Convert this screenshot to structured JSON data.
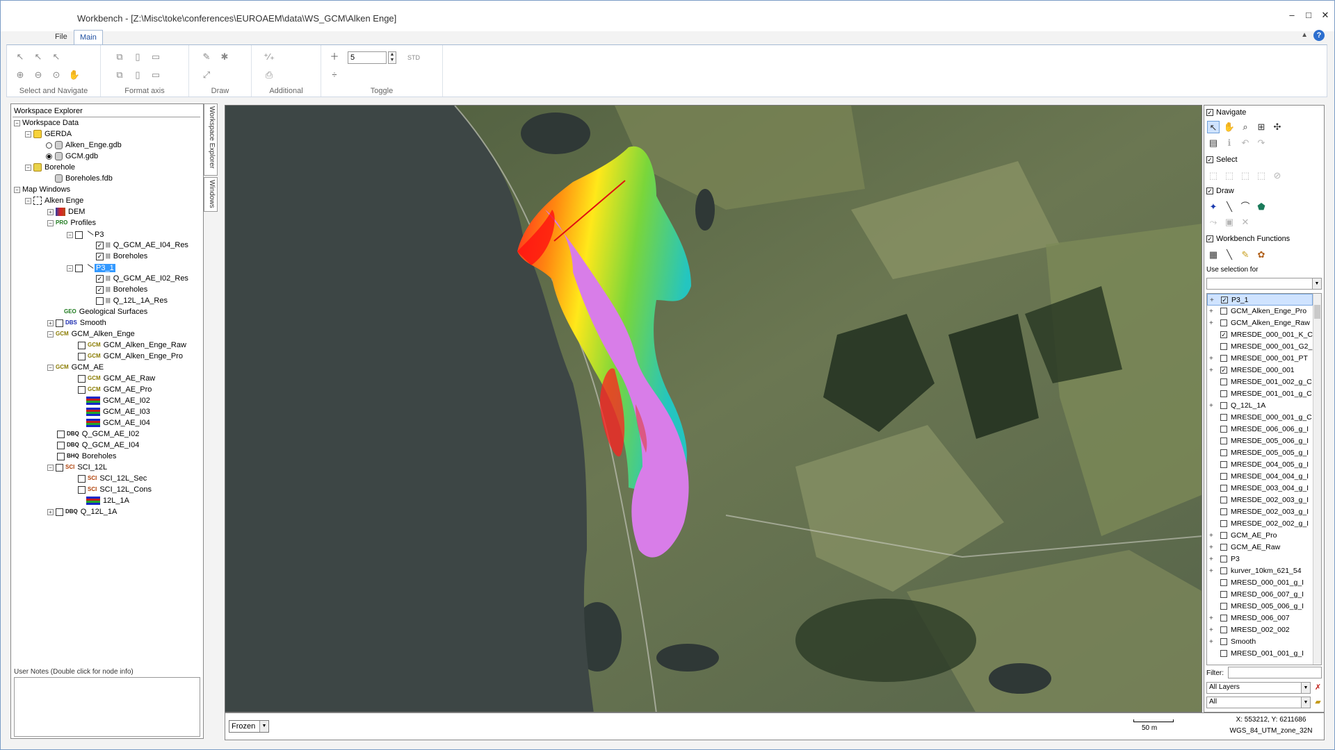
{
  "window": {
    "title": "Workbench  -  [Z:\\Misc\\toke\\conferences\\EUROAEM\\data\\WS_GCM\\Alken Enge]",
    "tabs": [
      {
        "label": "File"
      },
      {
        "label": "Main"
      }
    ],
    "help_label": "?"
  },
  "ribbon": {
    "groups": [
      {
        "label": "Select and Navigate"
      },
      {
        "label": "Format axis"
      },
      {
        "label": "Draw"
      },
      {
        "label": "Additional"
      },
      {
        "label": "Toggle"
      }
    ],
    "toggle_value": "5",
    "std_label": "STD"
  },
  "explorer": {
    "title": "Workspace Explorer",
    "side_tabs": [
      "Workspace Explorer",
      "Windows"
    ],
    "nodes": [
      {
        "label": "Workspace Data",
        "tag": ""
      },
      {
        "label": "GERDA",
        "tag": ""
      },
      {
        "label": "Alken_Enge.gdb",
        "tag": ""
      },
      {
        "label": "GCM.gdb",
        "tag": ""
      },
      {
        "label": "Borehole",
        "tag": ""
      },
      {
        "label": "Boreholes.fdb",
        "tag": ""
      },
      {
        "label": "Map Windows",
        "tag": ""
      },
      {
        "label": "Alken Enge",
        "tag": ""
      },
      {
        "label": "DEM",
        "tag": ""
      },
      {
        "label": "Profiles",
        "tag": "PRO"
      },
      {
        "label": "P3",
        "tag": ""
      },
      {
        "label": "Q_GCM_AE_I04_Res",
        "tag": ""
      },
      {
        "label": "Boreholes",
        "tag": ""
      },
      {
        "label": "P3_1",
        "tag": ""
      },
      {
        "label": "Q_GCM_AE_I02_Res",
        "tag": ""
      },
      {
        "label": "Boreholes",
        "tag": ""
      },
      {
        "label": "Q_12L_1A_Res",
        "tag": ""
      },
      {
        "label": "Geological Surfaces",
        "tag": "GEO"
      },
      {
        "label": "Smooth",
        "tag": "DBS"
      },
      {
        "label": "GCM_Alken_Enge",
        "tag": "GCM"
      },
      {
        "label": "GCM_Alken_Enge_Raw",
        "tag": "GCM"
      },
      {
        "label": "GCM_Alken_Enge_Pro",
        "tag": "GCM"
      },
      {
        "label": "GCM_AE",
        "tag": "GCM"
      },
      {
        "label": "GCM_AE_Raw",
        "tag": "GCM"
      },
      {
        "label": "GCM_AE_Pro",
        "tag": "GCM"
      },
      {
        "label": "GCM_AE_I02",
        "tag": ""
      },
      {
        "label": "GCM_AE_I03",
        "tag": ""
      },
      {
        "label": "GCM_AE_I04",
        "tag": ""
      },
      {
        "label": "Q_GCM_AE_I02",
        "tag": "DBQ"
      },
      {
        "label": "Q_GCM_AE_I04",
        "tag": "DBQ"
      },
      {
        "label": "Boreholes",
        "tag": "BHQ"
      },
      {
        "label": "SCI_12L",
        "tag": "SCI"
      },
      {
        "label": "SCI_12L_Sec",
        "tag": "SCI"
      },
      {
        "label": "SCI_12L_Cons",
        "tag": "SCI"
      },
      {
        "label": "12L_1A",
        "tag": ""
      },
      {
        "label": "Q_12L_1A",
        "tag": "DBQ"
      }
    ],
    "notes_title": "User Notes (Double click for node info)"
  },
  "right_panel": {
    "sections": {
      "navigate": "Navigate",
      "select": "Select",
      "draw": "Draw",
      "functions": "Workbench Functions"
    },
    "use_selection_label": "Use selection for",
    "layers": [
      {
        "label": "P3_1",
        "checked": true,
        "expandable": true,
        "selected": true
      },
      {
        "label": "GCM_Alken_Enge_Pro",
        "checked": false,
        "expandable": true,
        "selected": false
      },
      {
        "label": "GCM_Alken_Enge_Raw",
        "checked": false,
        "expandable": true,
        "selected": false
      },
      {
        "label": "MRESDE_000_001_K_C",
        "checked": true,
        "expandable": false,
        "selected": false
      },
      {
        "label": "MRESDE_000_001_G2_",
        "checked": false,
        "expandable": false,
        "selected": false
      },
      {
        "label": "MRESDE_000_001_PT",
        "checked": false,
        "expandable": true,
        "selected": false
      },
      {
        "label": "MRESDE_000_001",
        "checked": true,
        "expandable": true,
        "selected": false
      },
      {
        "label": "MRESDE_001_002_g_C",
        "checked": false,
        "expandable": false,
        "selected": false
      },
      {
        "label": "MRESDE_001_001_g_C",
        "checked": false,
        "expandable": false,
        "selected": false
      },
      {
        "label": "Q_12L_1A",
        "checked": false,
        "expandable": true,
        "selected": false
      },
      {
        "label": "MRESDE_000_001_g_C",
        "checked": false,
        "expandable": false,
        "selected": false
      },
      {
        "label": "MRESDE_006_006_g_I",
        "checked": false,
        "expandable": false,
        "selected": false
      },
      {
        "label": "MRESDE_005_006_g_I",
        "checked": false,
        "expandable": false,
        "selected": false
      },
      {
        "label": "MRESDE_005_005_g_I",
        "checked": false,
        "expandable": false,
        "selected": false
      },
      {
        "label": "MRESDE_004_005_g_I",
        "checked": false,
        "expandable": false,
        "selected": false
      },
      {
        "label": "MRESDE_004_004_g_I",
        "checked": false,
        "expandable": false,
        "selected": false
      },
      {
        "label": "MRESDE_003_004_g_I",
        "checked": false,
        "expandable": false,
        "selected": false
      },
      {
        "label": "MRESDE_002_003_g_I",
        "checked": false,
        "expandable": false,
        "selected": false
      },
      {
        "label": "MRESDE_002_003_g_I",
        "checked": false,
        "expandable": false,
        "selected": false
      },
      {
        "label": "MRESDE_002_002_g_I",
        "checked": false,
        "expandable": false,
        "selected": false
      },
      {
        "label": "GCM_AE_Pro",
        "checked": false,
        "expandable": true,
        "selected": false
      },
      {
        "label": "GCM_AE_Raw",
        "checked": false,
        "expandable": true,
        "selected": false
      },
      {
        "label": "P3",
        "checked": false,
        "expandable": true,
        "selected": false
      },
      {
        "label": "kurver_10km_621_54",
        "checked": false,
        "expandable": true,
        "selected": false
      },
      {
        "label": "MRESD_000_001_g_I",
        "checked": false,
        "expandable": false,
        "selected": false
      },
      {
        "label": "MRESD_006_007_g_I",
        "checked": false,
        "expandable": false,
        "selected": false
      },
      {
        "label": "MRESD_005_006_g_I",
        "checked": false,
        "expandable": false,
        "selected": false
      },
      {
        "label": "MRESD_006_007",
        "checked": false,
        "expandable": true,
        "selected": false
      },
      {
        "label": "MRESD_002_002",
        "checked": false,
        "expandable": true,
        "selected": false
      },
      {
        "label": "Smooth",
        "checked": false,
        "expandable": true,
        "selected": false
      },
      {
        "label": "MRESD_001_001_g_I",
        "checked": false,
        "expandable": false,
        "selected": false
      }
    ],
    "filter_label": "Filter:",
    "layer_filter": "All Layers",
    "type_filter": "All"
  },
  "status": {
    "frozen": "Frozen",
    "scale_label": "50 m",
    "coords": "X: 553212, Y: 6211686",
    "crs": "WGS_84_UTM_zone_32N"
  },
  "colors": {
    "accent": "#1e4fa0",
    "lake": "#3d4645",
    "land": "#5f6e4a",
    "field": "#8a9468",
    "forest": "#2b3a24",
    "resistivity_low": "#d87de8",
    "resistivity_high": "#ff1f1f"
  }
}
